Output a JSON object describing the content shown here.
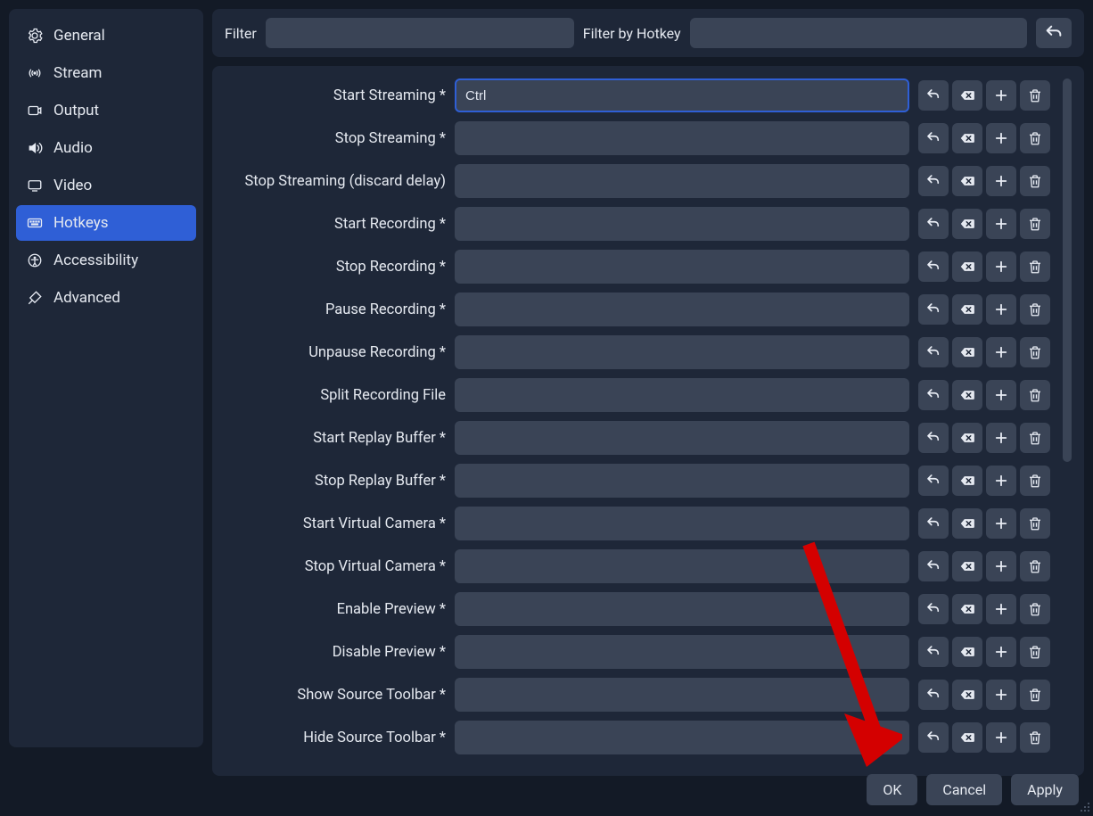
{
  "sidebar": {
    "items": [
      {
        "id": "general",
        "label": "General"
      },
      {
        "id": "stream",
        "label": "Stream"
      },
      {
        "id": "output",
        "label": "Output"
      },
      {
        "id": "audio",
        "label": "Audio"
      },
      {
        "id": "video",
        "label": "Video"
      },
      {
        "id": "hotkeys",
        "label": "Hotkeys"
      },
      {
        "id": "accessibility",
        "label": "Accessibility"
      },
      {
        "id": "advanced",
        "label": "Advanced"
      }
    ],
    "active_id": "hotkeys"
  },
  "filter": {
    "label": "Filter",
    "value": "",
    "hotkey_label": "Filter by Hotkey",
    "hotkey_value": ""
  },
  "hotkeys": [
    {
      "id": "start-streaming",
      "label": "Start Streaming *",
      "value": "Ctrl",
      "focused": true
    },
    {
      "id": "stop-streaming",
      "label": "Stop Streaming *",
      "value": ""
    },
    {
      "id": "stop-streaming-discard",
      "label": "Stop Streaming (discard delay)",
      "value": ""
    },
    {
      "id": "start-recording",
      "label": "Start Recording *",
      "value": ""
    },
    {
      "id": "stop-recording",
      "label": "Stop Recording *",
      "value": ""
    },
    {
      "id": "pause-recording",
      "label": "Pause Recording *",
      "value": ""
    },
    {
      "id": "unpause-recording",
      "label": "Unpause Recording *",
      "value": ""
    },
    {
      "id": "split-recording",
      "label": "Split Recording File",
      "value": ""
    },
    {
      "id": "start-replay-buffer",
      "label": "Start Replay Buffer *",
      "value": ""
    },
    {
      "id": "stop-replay-buffer",
      "label": "Stop Replay Buffer *",
      "value": ""
    },
    {
      "id": "start-virtual-camera",
      "label": "Start Virtual Camera *",
      "value": ""
    },
    {
      "id": "stop-virtual-camera",
      "label": "Stop Virtual Camera *",
      "value": ""
    },
    {
      "id": "enable-preview",
      "label": "Enable Preview *",
      "value": ""
    },
    {
      "id": "disable-preview",
      "label": "Disable Preview *",
      "value": ""
    },
    {
      "id": "show-source-toolbar",
      "label": "Show Source Toolbar *",
      "value": ""
    },
    {
      "id": "hide-source-toolbar",
      "label": "Hide Source Toolbar *",
      "value": ""
    }
  ],
  "footer": {
    "ok": "OK",
    "cancel": "Cancel",
    "apply": "Apply"
  }
}
